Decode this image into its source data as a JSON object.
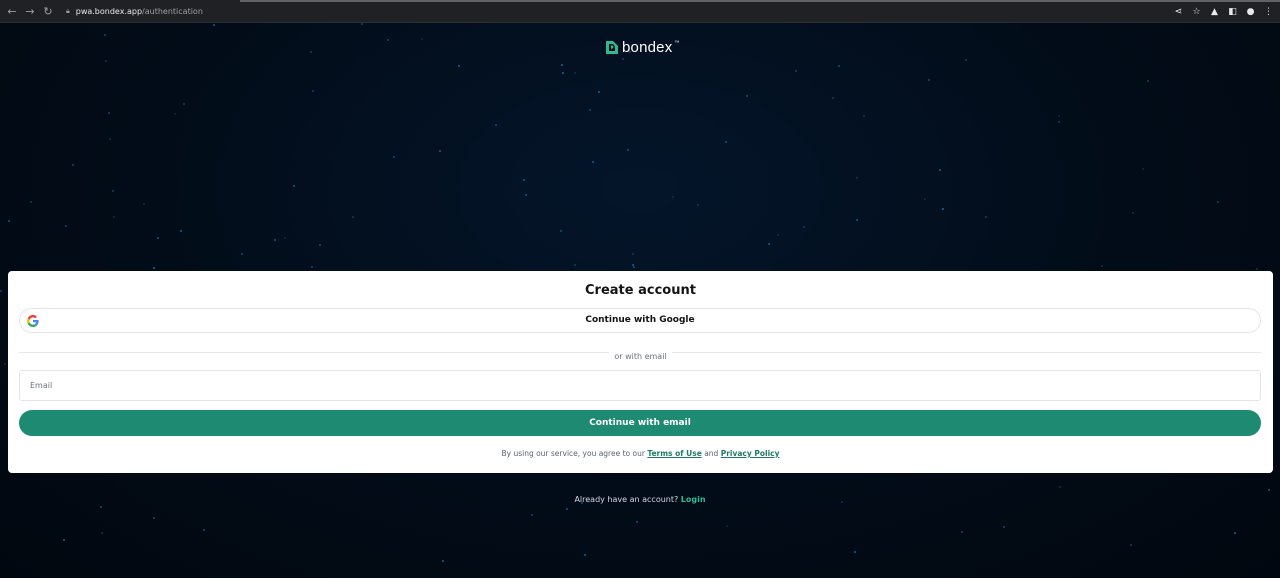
{
  "browser": {
    "url_host": "pwa.bondex.app",
    "url_path": "/authentication",
    "back_icon": "arrow-left-icon",
    "forward_icon": "arrow-right-icon",
    "reload_icon": "reload-icon",
    "lock_icon": "lock-icon",
    "action_icons": [
      "share-icon",
      "star-icon",
      "extension-icon",
      "sidebar-icon",
      "profile-icon",
      "menu-icon"
    ]
  },
  "brand": {
    "name": "bondex",
    "trademark": "™",
    "logo_icon": "bondex-logo-icon",
    "accent_color": "#1f8a72"
  },
  "signup": {
    "title": "Create account",
    "google_button_label": "Continue with Google",
    "google_icon": "google-g-icon",
    "divider_text": "or with email",
    "email_placeholder": "Email",
    "email_value": "",
    "email_button_label": "Continue with email",
    "terms_prefix": "By using our service, you agree to our",
    "terms_link": "Terms of Use",
    "terms_and": "and",
    "privacy_link": "Privacy Policy"
  },
  "footer": {
    "already_text": "Already have an account?",
    "login_link": "Login"
  }
}
